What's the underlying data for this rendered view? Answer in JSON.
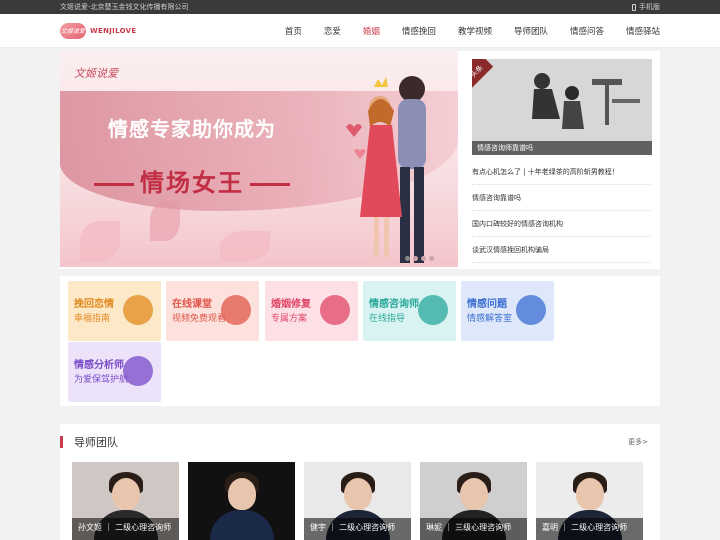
{
  "topbar": {
    "company": "文姬说爱-北京楚玉金钱文化传播有限公司",
    "mobile": "手机版"
  },
  "header": {
    "logo_mark": "文姬说爱",
    "logo_text": "WENJILOVE",
    "nav": [
      "首页",
      "恋爱",
      "婚姻",
      "情感挽回",
      "教学视频",
      "导师团队",
      "情感问答",
      "情感驿站"
    ],
    "active_nav": "婚姻"
  },
  "banner": {
    "logo": "文姬说爱",
    "title": "情感专家助你成为",
    "subtitle": "情场女王"
  },
  "headline": {
    "ribbon": "头条",
    "caption": "情感咨询师靠谱吗",
    "items": [
      "有点心机怎么了 | 十年老绿茶的高阶斩男教程！",
      "情感咨询靠谱吗",
      "国内口碑较好的情感咨询机构",
      "谈武汉情感挽回机构骗局"
    ]
  },
  "cards": [
    {
      "t1": "挽回恋情",
      "t2": "幸福指南",
      "bg": "#fde9c8",
      "fg": "#e08a1e",
      "icon": "book-icon"
    },
    {
      "t1": "在线课堂",
      "t2": "视频免费观看",
      "bg": "#fde1dc",
      "fg": "#e0574a",
      "icon": "diamond-icon"
    },
    {
      "t1": "婚姻修复",
      "t2": "专属方案",
      "bg": "#fde0e6",
      "fg": "#e04868",
      "icon": "heart-icon"
    },
    {
      "t1": "情感咨询师",
      "t2": "在线指导",
      "bg": "#d8f3f1",
      "fg": "#2aa79b",
      "icon": "house-icon"
    },
    {
      "t1": "情感问题",
      "t2": "情感解答室",
      "bg": "#dfe8fb",
      "fg": "#3a6fd1",
      "icon": "bulb-icon"
    },
    {
      "t1": "情感分析师",
      "t2": "为爱保驾护航",
      "bg": "#ece2fa",
      "fg": "#7a4bc8",
      "icon": "drop-icon"
    }
  ],
  "team": {
    "title": "导师团队",
    "more": "更多>",
    "members": [
      {
        "name": "孙文姬 ｜ 二级心理咨询师",
        "bg": "#cfc7c4",
        "suit": "#2a2a2a"
      },
      {
        "name": "",
        "bg": "#111111",
        "suit": "#1c2a4a"
      },
      {
        "name": "健宇 ｜ 二级心理咨询师",
        "bg": "#e9e9e9",
        "suit": "#1d2538"
      },
      {
        "name": "琳妮 ｜ 三级心理咨询师",
        "bg": "#cfcfcf",
        "suit": "#222"
      },
      {
        "name": "嘉明 ｜ 二级心理咨询师",
        "bg": "#ececec",
        "suit": "#1d2538"
      }
    ]
  }
}
